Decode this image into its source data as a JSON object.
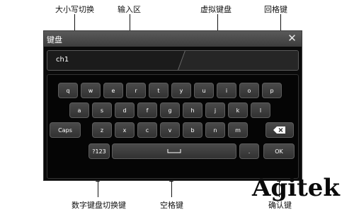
{
  "annotations": {
    "case_toggle": "大小写切换",
    "input_area": "输入区",
    "virtual_keyboard": "虚拟键盘",
    "backspace": "回格键",
    "numeric_toggle": "数字键盘切换键",
    "space": "空格键",
    "confirm": "确认键"
  },
  "dialog": {
    "title": "键盘",
    "close_icon": "close-icon"
  },
  "input": {
    "value": "ch1"
  },
  "keyboard": {
    "row1": [
      "q",
      "w",
      "e",
      "r",
      "t",
      "y",
      "u",
      "i",
      "o",
      "p"
    ],
    "row2": [
      "a",
      "s",
      "d",
      "f",
      "g",
      "h",
      "j",
      "k",
      "l"
    ],
    "row3": [
      "z",
      "x",
      "c",
      "v",
      "b",
      "n",
      "m"
    ],
    "caps_label": "Caps",
    "backspace_icon": "backspace-icon",
    "numeric_label": "?123",
    "space_icon": "space-bar-icon",
    "dot_label": ".",
    "ok_label": "OK"
  },
  "watermark": {
    "text": "Agitek"
  },
  "colors": {
    "window_bg": "#0a0a0a",
    "titlebar": "#4a4a4a",
    "key_bg": "#3c3c3c",
    "key_text": "#ffffff"
  }
}
